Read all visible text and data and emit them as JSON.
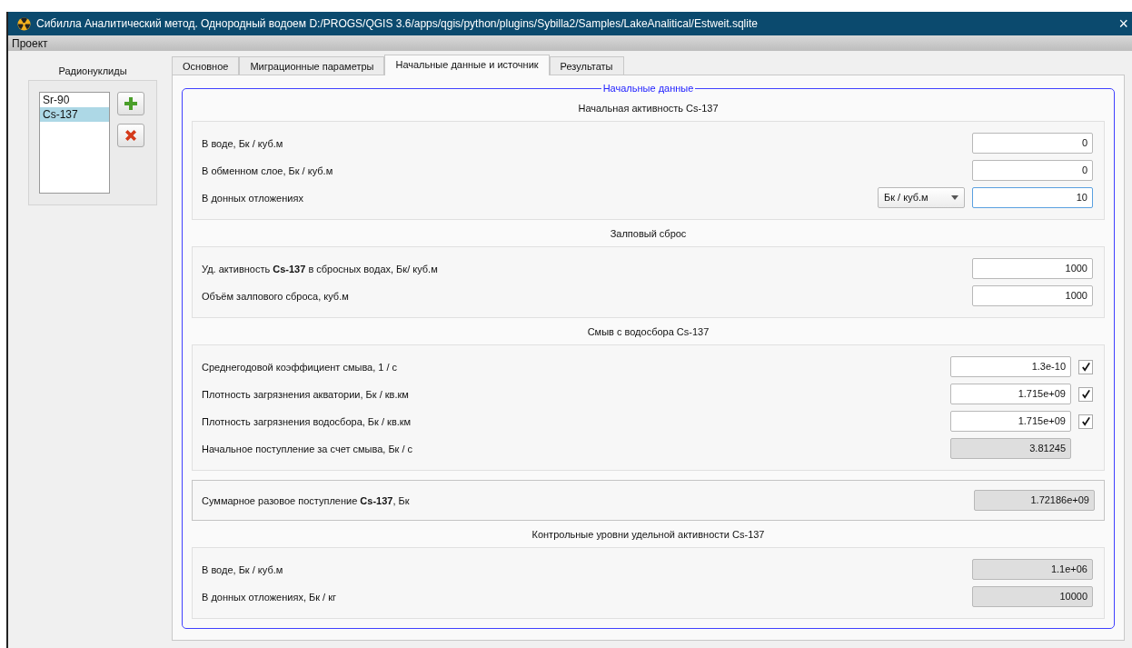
{
  "window": {
    "title": "Сибилла Аналитический метод. Однородный водоем D:/PROGS/QGIS 3.6/apps/qgis/python/plugins/Sybilla2/Samples/LakeAnalitical/Estweit.sqlite",
    "close": "×"
  },
  "menu": [
    "Проект"
  ],
  "nuclides": {
    "title": "Радионуклиды",
    "items": [
      {
        "label": "Sr-90",
        "selected": false
      },
      {
        "label": "Cs-137",
        "selected": true
      }
    ]
  },
  "tabs": [
    {
      "label": "Основное",
      "selected": false
    },
    {
      "label": "Миграционные параметры",
      "selected": false
    },
    {
      "label": "Начальные данные и источник",
      "selected": true
    },
    {
      "label": "Результаты",
      "selected": false
    }
  ],
  "group_title": "Начальные данные",
  "sections": [
    {
      "title": "Начальная активность Cs-137",
      "rows": [
        {
          "kind": "field",
          "label": "В воде, Бк / куб.м",
          "value": "0"
        },
        {
          "kind": "field",
          "label": "В обменном слое, Бк / куб.м",
          "value": "0"
        },
        {
          "kind": "combo",
          "label": "В донных отложениях",
          "unit": "Бк / куб.м",
          "value": "10"
        }
      ]
    },
    {
      "title": "Залповый сброс",
      "rows": [
        {
          "kind": "field",
          "label": "Уд. активность **Cs-137** в сбросных водах, Бк/ куб.м",
          "value": "1000"
        },
        {
          "kind": "field",
          "label": "Объём залпового сброса, куб.м",
          "value": "1000"
        }
      ]
    },
    {
      "title": "Смыв с водосбора Cs-137",
      "rows": [
        {
          "kind": "check",
          "label": "Среднегодовой коэффициент смыва, 1 / с",
          "value": "1.3e-10",
          "checked": true
        },
        {
          "kind": "check",
          "label": "Плотность загрязнения акватории, Бк / кв.км",
          "value": "1.715e+09",
          "checked": true
        },
        {
          "kind": "check",
          "label": "Плотность загрязнения водосбора, Бк / кв.км",
          "value": "1.715e+09",
          "checked": true
        },
        {
          "kind": "readonly_narrow",
          "label": "Начальное поступление за счет смыва, Бк / с",
          "value": "3.81245"
        }
      ]
    },
    {
      "rows": [
        {
          "kind": "readonly",
          "label": "Суммарное разовое поступление **Cs-137**, Бк",
          "value": "1.72186e+09"
        }
      ]
    },
    {
      "title": "Контрольные уровни удельной активности Cs-137",
      "rows": [
        {
          "kind": "readonly",
          "label": "В воде, Бк / куб.м",
          "value": "1.1e+06"
        },
        {
          "kind": "readonly",
          "label": "В донных отложениях, Бк / кг",
          "value": "10000"
        }
      ]
    }
  ]
}
